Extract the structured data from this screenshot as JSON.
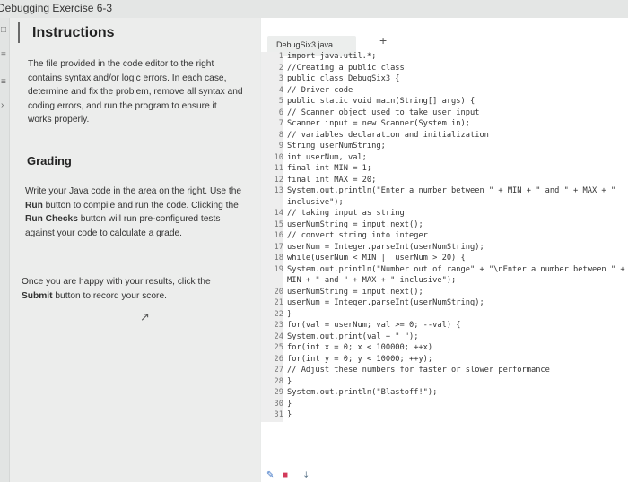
{
  "topbar": {
    "breadcrumb": "Debugging Exercise 6-3"
  },
  "left_icons": [
    "□",
    "≡",
    "≡",
    "›"
  ],
  "instructions": {
    "title": "Instructions",
    "intro": "The file provided in the code editor to the right contains syntax and/or logic errors. In each case, determine and fix the problem, remove all syntax and coding errors, and run the program to ensure it works properly.",
    "grading_title": "Grading",
    "grading_p1_a": "Write your Java code in the area on the right. Use the ",
    "grading_p1_run": "Run",
    "grading_p1_b": " button to compile and run the code. Clicking the ",
    "grading_p1_checks": "Run Checks",
    "grading_p1_c": " button will run pre-configured tests against your code to calculate a grade.",
    "grading_p2_a": "Once you are happy with your results, click the ",
    "grading_p2_submit": "Submit",
    "grading_p2_b": " button to record your score."
  },
  "editor": {
    "file_tab": "DebugSix3.java",
    "add_tab": "+",
    "lines": [
      {
        "n": "1",
        "t": "import java.util.*;"
      },
      {
        "n": "2",
        "t": "//Creating a public class"
      },
      {
        "n": "3",
        "t": "public class DebugSix3 {"
      },
      {
        "n": "4",
        "t": "// Driver code"
      },
      {
        "n": "5",
        "t": "public static void main(String[] args) {"
      },
      {
        "n": "6",
        "t": "// Scanner object used to take user input"
      },
      {
        "n": "7",
        "t": "Scanner input = new Scanner(System.in);"
      },
      {
        "n": "8",
        "t": "// variables declaration and initialization"
      },
      {
        "n": "9",
        "t": "String userNumString;"
      },
      {
        "n": "10",
        "t": "int userNum, val;"
      },
      {
        "n": "11",
        "t": "final int MIN = 1;"
      },
      {
        "n": "12",
        "t": "final int MAX = 20;"
      },
      {
        "n": "13",
        "t": "System.out.println(\"Enter a number between \" + MIN + \" and \" + MAX + \""
      },
      {
        "n": "",
        "t": "inclusive\");"
      },
      {
        "n": "14",
        "t": "// taking input as string"
      },
      {
        "n": "15",
        "t": "userNumString = input.next();"
      },
      {
        "n": "16",
        "t": "// convert string into integer"
      },
      {
        "n": "17",
        "t": "userNum = Integer.parseInt(userNumString);"
      },
      {
        "n": "18",
        "t": "while(userNum < MIN || userNum > 20) {"
      },
      {
        "n": "19",
        "t": "System.out.println(\"Number out of range\" + \"\\nEnter a number between \" +"
      },
      {
        "n": "",
        "t": "MIN + \" and \" + MAX + \" inclusive\");"
      },
      {
        "n": "20",
        "t": "userNumString = input.next();"
      },
      {
        "n": "21",
        "t": "userNum = Integer.parseInt(userNumString);"
      },
      {
        "n": "22",
        "t": "}"
      },
      {
        "n": "23",
        "t": "for(val = userNum; val >= 0; --val) {"
      },
      {
        "n": "24",
        "t": "System.out.print(val + \" \");"
      },
      {
        "n": "25",
        "t": "for(int x = 0; x < 100000; ++x)"
      },
      {
        "n": "26",
        "t": "for(int y = 0; y < 10000; ++y);"
      },
      {
        "n": "27",
        "t": "// Adjust these numbers for faster or slower performance"
      },
      {
        "n": "28",
        "t": "}"
      },
      {
        "n": "29",
        "t": "System.out.println(\"Blastoff!\");"
      },
      {
        "n": "30",
        "t": "}"
      },
      {
        "n": "31",
        "t": "}"
      }
    ]
  },
  "bottom_icons": [
    "pencil-icon",
    "square-icon",
    "download-icon"
  ],
  "colors": {
    "accent_pencil": "#3a72c4",
    "accent_square": "#d23a5a",
    "accent_download": "#2f4f6a"
  }
}
